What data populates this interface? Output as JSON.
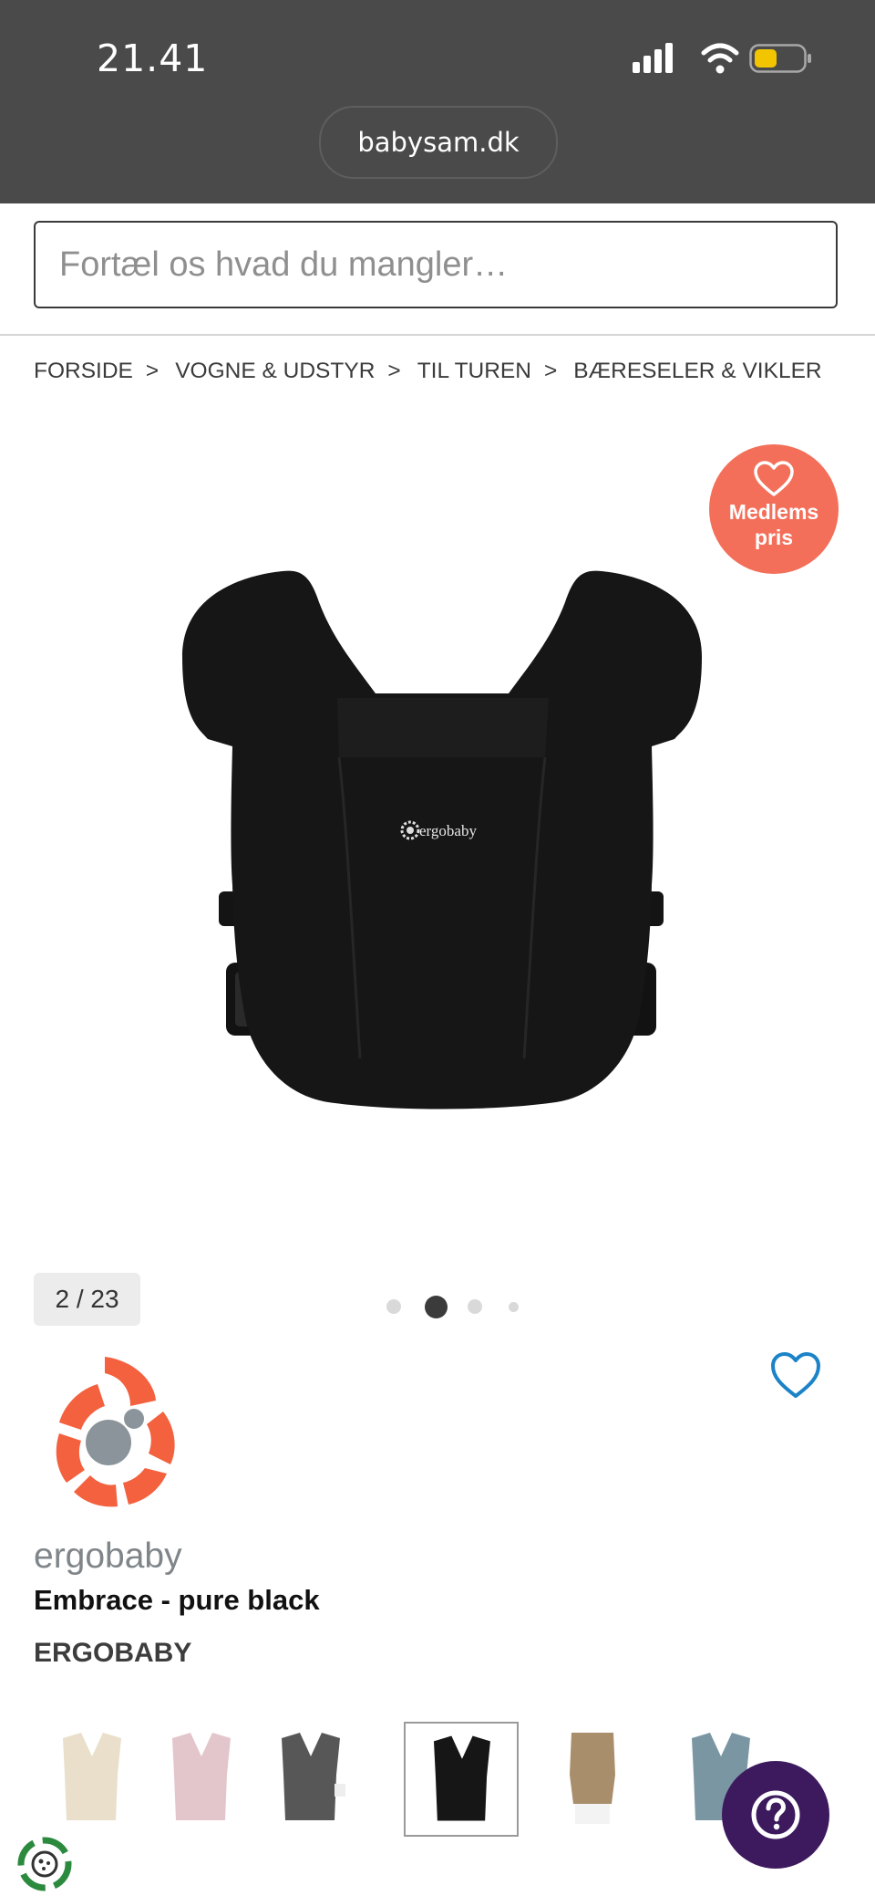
{
  "status_bar": {
    "time": "21.41",
    "url": "babysam.dk",
    "battery_color": "#f2c500"
  },
  "search": {
    "placeholder": "Fortæl os hvad du mangler…"
  },
  "breadcrumb": {
    "items": [
      "FORSIDE",
      "VOGNE & UDSTYR",
      "TIL TUREN",
      "BÆRESELER & VIKLER"
    ],
    "separator": ">"
  },
  "badge": {
    "line1": "Medlems",
    "line2": "pris",
    "color": "#f36f5a"
  },
  "gallery": {
    "counter": "2 / 23",
    "image_logo_text": "ergobaby"
  },
  "product": {
    "brand_logo_text": "ergobaby",
    "title": "Embrace - pure black",
    "brand": "ERGOBABY"
  },
  "colors": {
    "accent": "#1c83c8",
    "help_button": "#3d1a5e"
  }
}
